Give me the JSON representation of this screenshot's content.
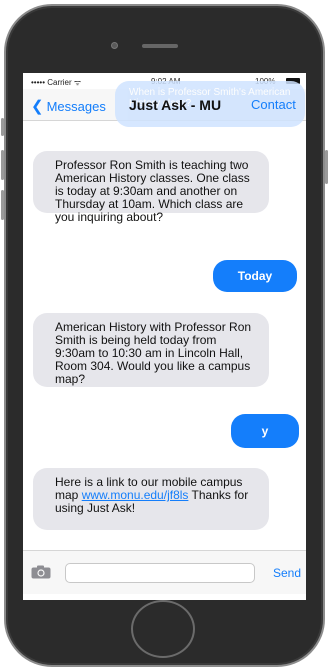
{
  "status_bar": {
    "carrier": "••••• Carrier ᯤ",
    "time": "9:02 AM",
    "battery": "100%"
  },
  "nav": {
    "back_label": "Messages",
    "title": "Just Ask - MU",
    "contact_label": "Contact",
    "ghost_text": "When is Professor Smith's American History class?"
  },
  "messages": [
    {
      "direction": "in",
      "text": "Professor Ron Smith is teaching two American History classes. One class is today at 9:30am and another on Thursday at 10am. Which class are you inquiring about?"
    },
    {
      "direction": "out",
      "text": "Today"
    },
    {
      "direction": "in",
      "text": "American History with Professor Ron Smith is being held today from 9:30am to 10:30 am in Lincoln Hall, Room 304. Would you like a campus map?"
    },
    {
      "direction": "out",
      "text": "y"
    },
    {
      "direction": "in",
      "text_before": "Here is a link to our mobile campus map ",
      "link": "www.monu.edu/jf8ls",
      "text_after": " Thanks for using Just Ask!"
    }
  ],
  "input_bar": {
    "placeholder": "",
    "send_label": "Send"
  },
  "colors": {
    "accent": "#147efb",
    "incoming_bubble": "#e6e6eb",
    "outgoing_bubble": "#147efb"
  }
}
